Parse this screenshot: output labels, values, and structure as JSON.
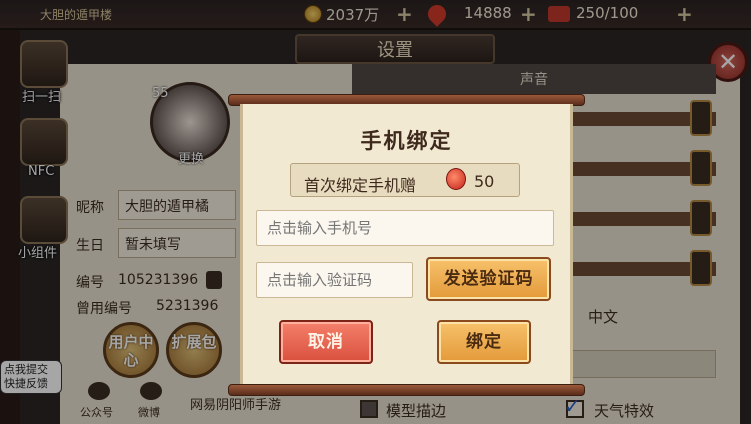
{
  "hud": {
    "player_name": "大胆的遁甲楼",
    "coins": "2037万",
    "jade": "14888",
    "stamina": "250/100"
  },
  "left_menu": {
    "scan": "扫一扫",
    "nfc": "NFC",
    "widget": "小组件"
  },
  "settings": {
    "title": "设置",
    "sound_header": "声音",
    "level": "55",
    "change_label": "更换",
    "nickname_label": "昵称",
    "nickname_value": "大胆的遁甲橘",
    "birthday_label": "生日",
    "birthday_value": "暂未填写",
    "id_label": "编号",
    "id_value": "105231396",
    "old_id_label": "曾用编号",
    "old_id_value": "5231396",
    "user_center": "用户中心",
    "expansion_pack": "扩展包",
    "feedback": "点我提交快捷反馈",
    "wechat_label": "公众号",
    "weibo_label": "微博",
    "netease_label": "网易阴阳师手游",
    "language_value": "中文",
    "model_outline": "模型描边",
    "weather_effects": "天气特效"
  },
  "dialog": {
    "title": "手机绑定",
    "first_bind_reward": "首次绑定手机赠",
    "reward_amount": "50",
    "phone_placeholder": "点击输入手机号",
    "code_placeholder": "点击输入验证码",
    "send_code_button": "发送验证码",
    "cancel_button": "取消",
    "bind_button": "绑定"
  }
}
